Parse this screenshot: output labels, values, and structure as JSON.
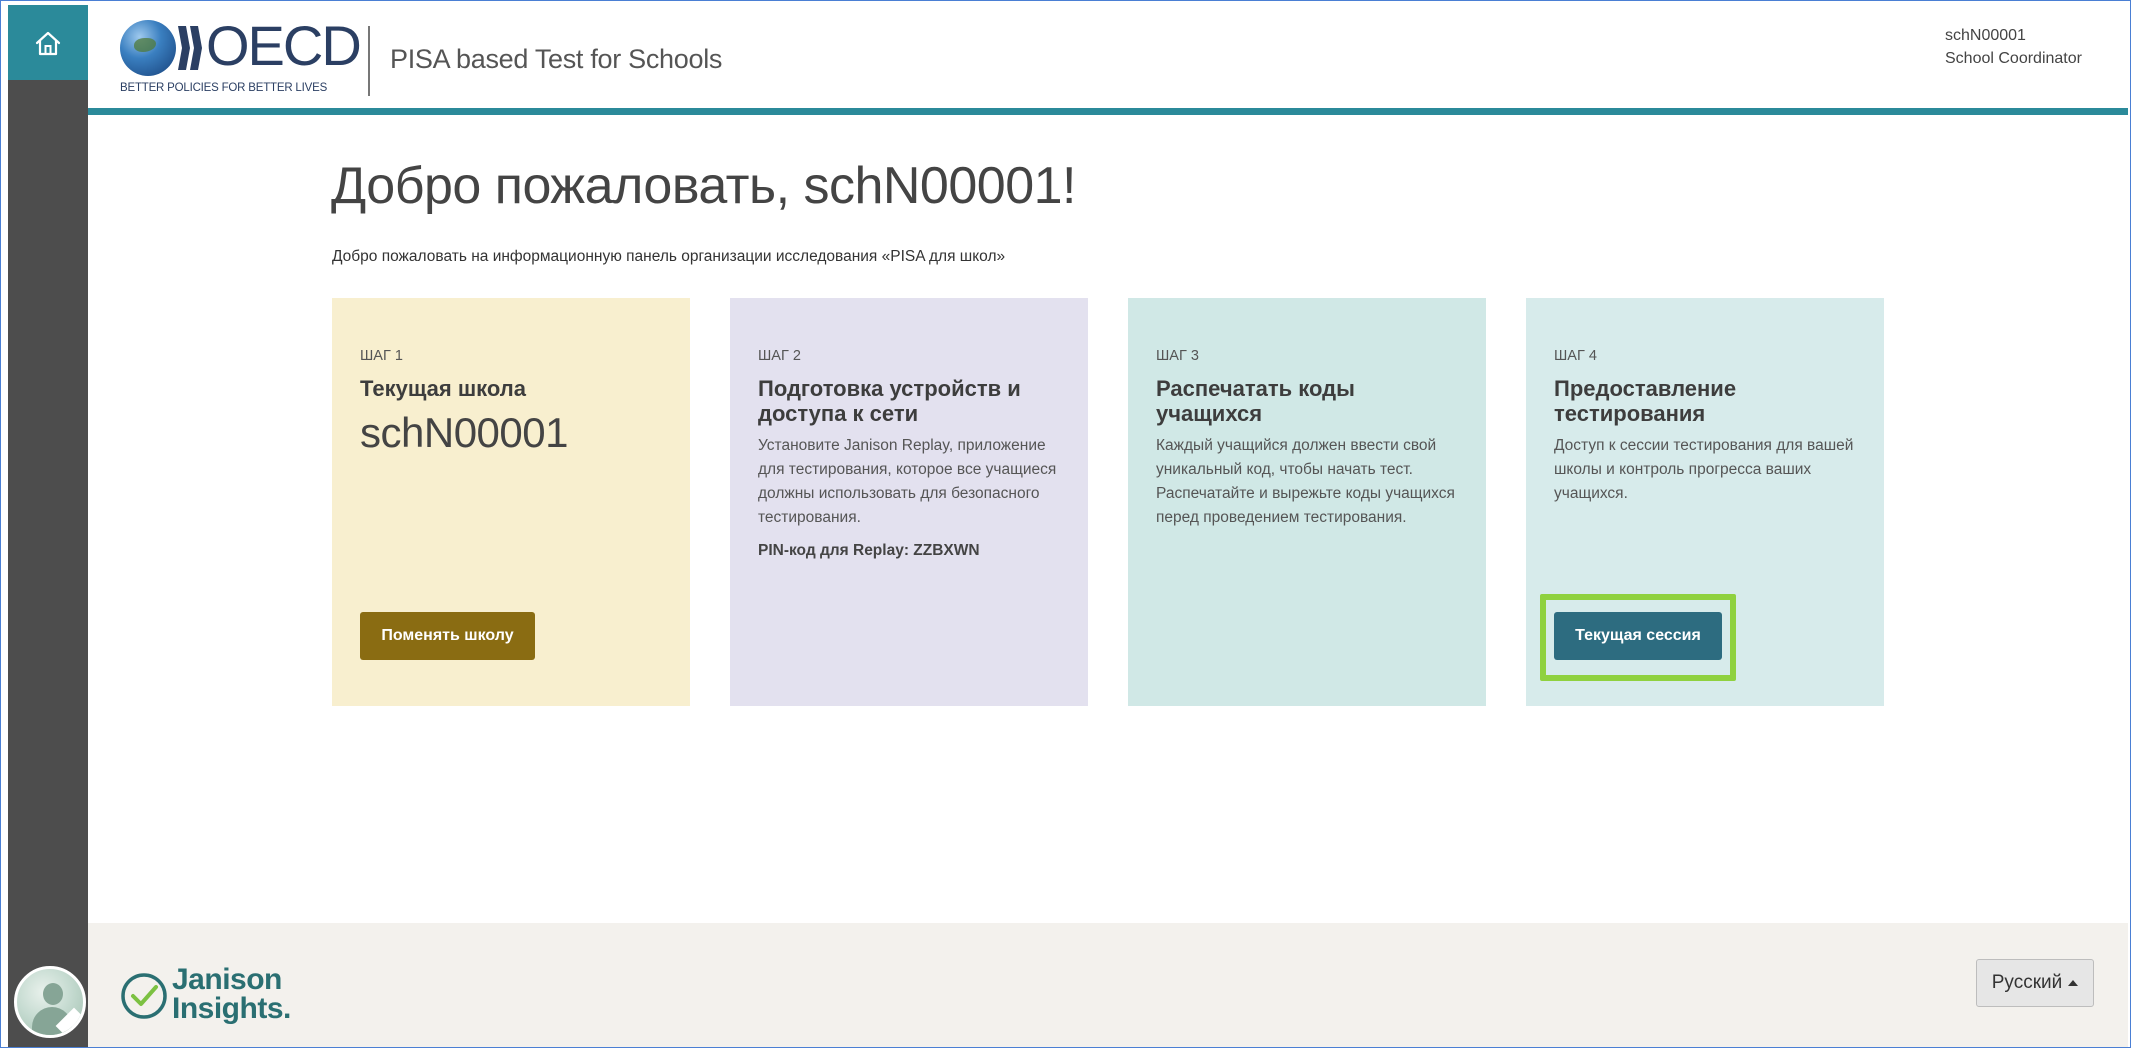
{
  "header": {
    "logo_word": "OECD",
    "logo_tagline": "BETTER POLICIES FOR BETTER LIVES",
    "app_title": "PISA based Test for Schools",
    "user_name": "schN00001",
    "user_role": "School Coordinator"
  },
  "main": {
    "title": "Добро пожаловать, schN00001!",
    "subtitle": "Добро пожаловать на информационную панель организации исследования «PISA для школ»",
    "cards": [
      {
        "step": "ШАГ 1",
        "title": "Текущая школа",
        "school_code": "schN00001",
        "button_label": "Поменять школу"
      },
      {
        "step": "ШАГ 2",
        "title": "Подготовка устройств и доступа к сети",
        "description": "Установите Janison Replay, приложение для тестирования, которое все учащиеся должны использовать для безопасного тестирования.",
        "pin": "PIN-код для Replay: ZZBXWN"
      },
      {
        "step": "ШАГ 3",
        "title": "Распечатать коды учащихся",
        "description": "Каждый учащийся должен ввести свой уникальный код, чтобы начать тест. Распечатайте и вырежьте коды учащихся перед проведением тестирования."
      },
      {
        "step": "ШАГ 4",
        "title": "Предоставление тестирования",
        "description": "Доступ к сессии тестирования для вашей школы и контроль прогресса ваших учащихся.",
        "button_label": "Текущая сессия"
      }
    ]
  },
  "footer": {
    "brand_line1": "Janison",
    "brand_line2": "Insights.",
    "language": "Русский"
  },
  "colors": {
    "accent_teal": "#2b8a9a",
    "rail": "#4d4d4d",
    "card1_bg": "#f8efcf",
    "card2_bg": "#e3e1ef",
    "card3_bg": "#d0e8e6",
    "card4_bg": "#d7ebeb",
    "button_gold": "#8a6c12",
    "button_teal": "#2d6c80",
    "highlight_green": "#8fd13f"
  },
  "icons": {
    "home": "home-icon",
    "avatar": "user-avatar",
    "language_caret": "caret-up-icon",
    "janison_check": "check-circle-icon"
  }
}
